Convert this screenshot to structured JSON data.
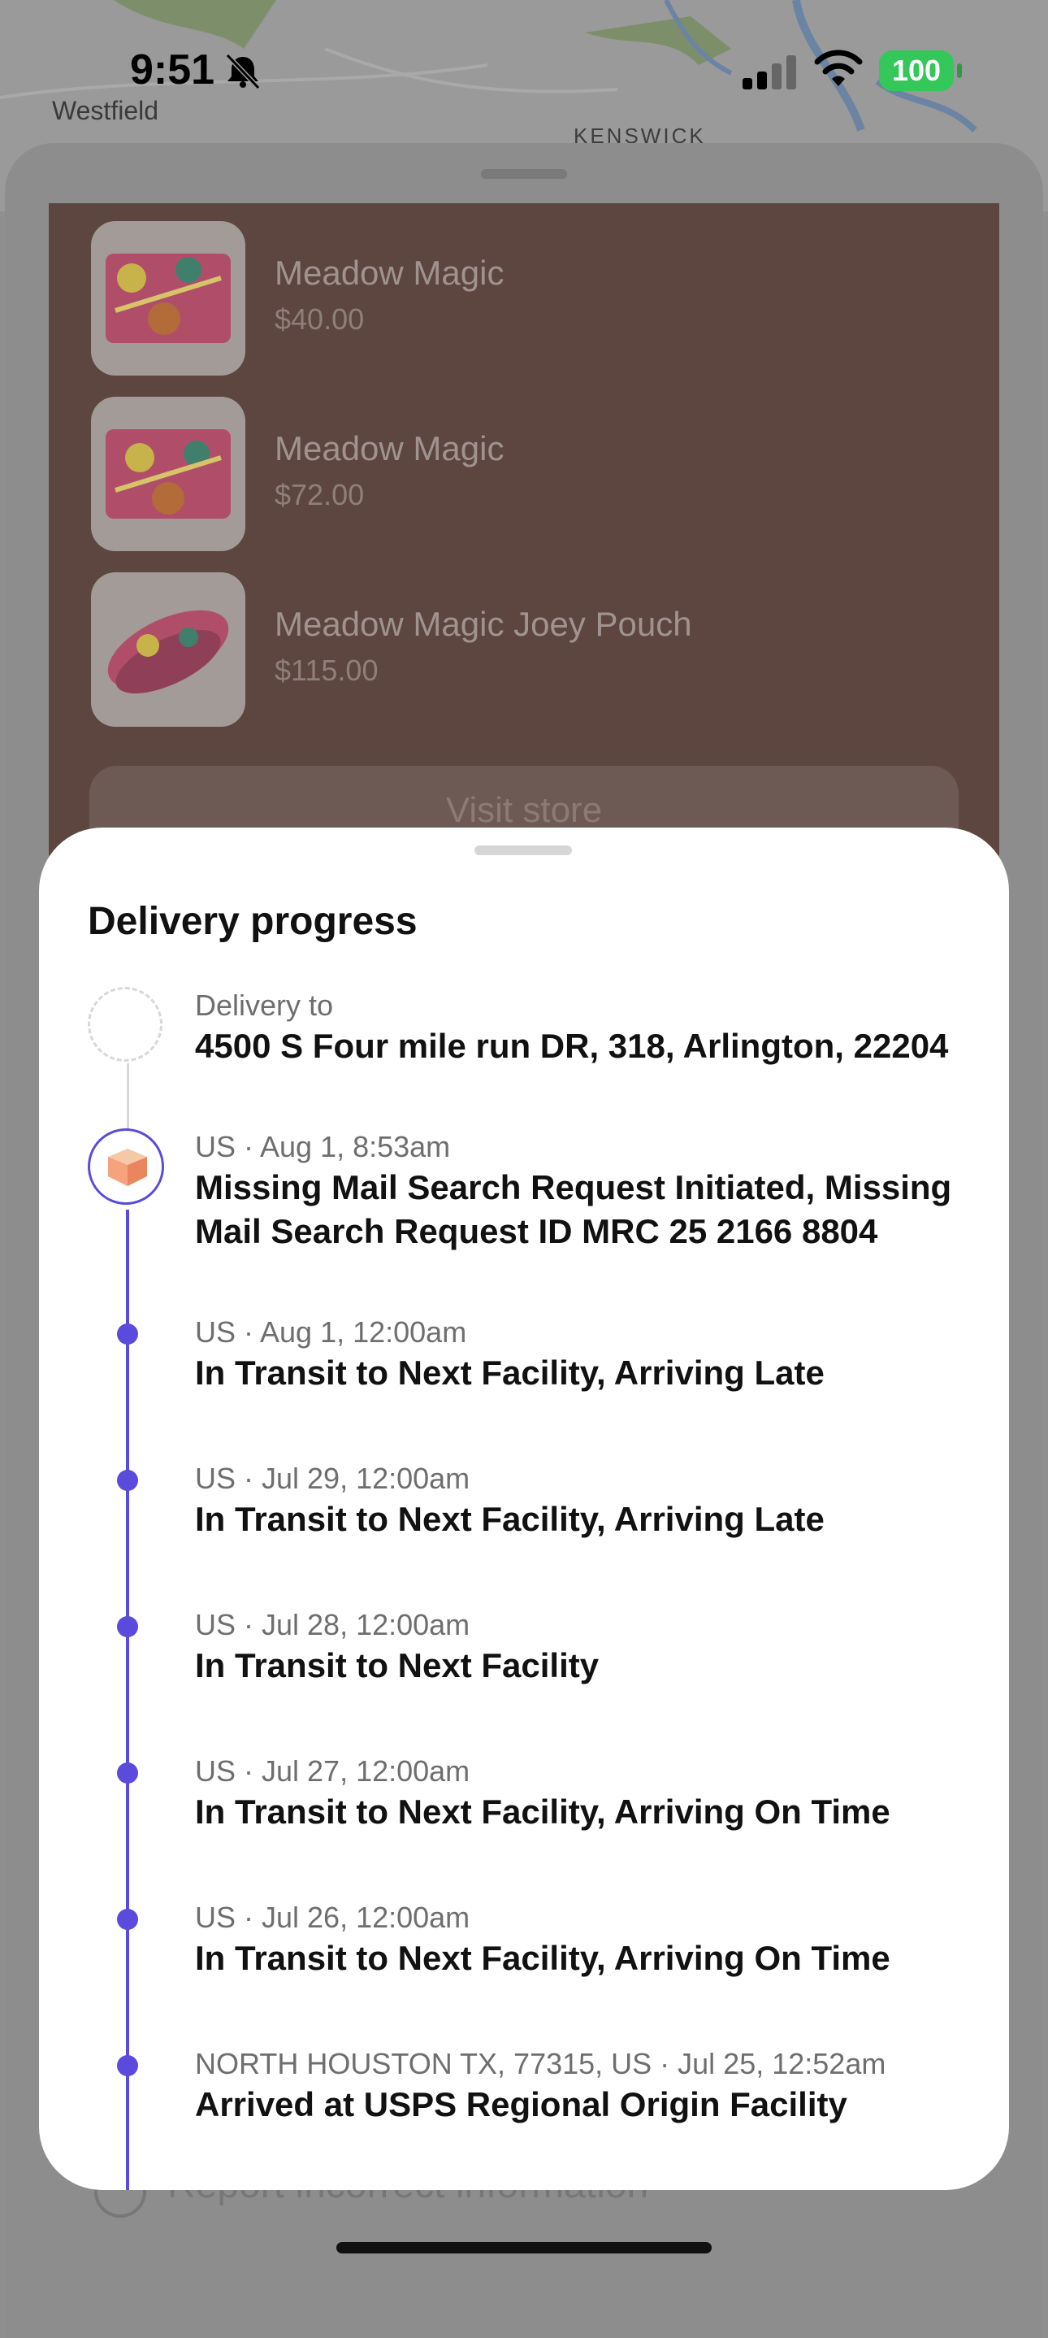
{
  "status_bar": {
    "time": "9:51",
    "battery": "100",
    "battery_color": "#34c759"
  },
  "map": {
    "labels": [
      "Westfield",
      "KENSWICK"
    ]
  },
  "store": {
    "products": [
      {
        "name": "Meadow Magic",
        "price": "$40.00"
      },
      {
        "name": "Meadow Magic",
        "price": "$72.00"
      },
      {
        "name": "Meadow Magic Joey Pouch",
        "price": "$115.00"
      }
    ],
    "visit_store_label": "Visit store",
    "report_label": "Report incorrect information"
  },
  "delivery": {
    "title": "Delivery progress",
    "accent_color": "#5a4bdc",
    "destination": {
      "meta": "Delivery to",
      "address": "4500 S Four mile run DR, 318, Arlington, 22204"
    },
    "events": [
      {
        "meta": "US · Aug 1, 8:53am",
        "title": "Missing Mail Search Request Initiated, Missing Mail Search Request ID MRC 25 2166 8804",
        "icon": "package-icon"
      },
      {
        "meta": "US · Aug 1, 12:00am",
        "title": "In Transit to Next Facility, Arriving Late"
      },
      {
        "meta": "US · Jul 29, 12:00am",
        "title": "In Transit to Next Facility, Arriving Late"
      },
      {
        "meta": "US · Jul 28, 12:00am",
        "title": "In Transit to Next Facility"
      },
      {
        "meta": "US · Jul 27, 12:00am",
        "title": "In Transit to Next Facility, Arriving On Time"
      },
      {
        "meta": "US · Jul 26, 12:00am",
        "title": "In Transit to Next Facility, Arriving On Time"
      },
      {
        "meta": "NORTH HOUSTON TX, 77315, US · Jul 25, 12:52am",
        "title": "Arrived at USPS Regional Origin Facility"
      }
    ]
  }
}
